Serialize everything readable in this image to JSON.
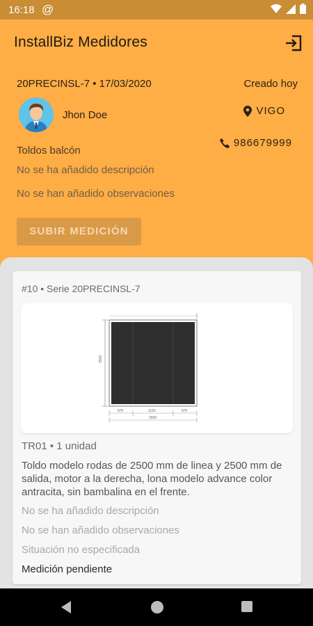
{
  "status": {
    "time": "16:18",
    "at_icon": "@"
  },
  "appbar": {
    "title": "InstallBiz Medidores",
    "logout_icon": "logout-icon"
  },
  "job": {
    "code_date": "20PRECINSL-7 • 17/03/2020",
    "created": "Creado hoy",
    "client": "Jhon Doe",
    "city": "VIGO",
    "phone": "986679999",
    "product": "Toldos balcón",
    "no_description": "No se ha añadido descripción",
    "no_observations": "No se han añadido observaciones",
    "upload_label": "SUBIR MEDICIÓN"
  },
  "card": {
    "series": "#10 • Serie 20PRECINSL-7",
    "code": "TR01 • 1 unidad",
    "details": "Toldo modelo rodas de 2500 mm de linea y 2500 mm de salida, motor a la derecha, lona modelo advance color antracita, sin bambalina en el frente.",
    "no_description": "No se ha añadido descripción",
    "no_observations": "No se han añadido observaciones",
    "situation": "Situación no especificada",
    "status": "Medición pendiente",
    "drawing": {
      "height_label": "2500",
      "segments": [
        "875",
        "1150",
        "875"
      ],
      "total": "2500"
    }
  },
  "colors": {
    "primary": "#ffad45",
    "status_bar": "#c88d35",
    "button": "#d99a48"
  }
}
